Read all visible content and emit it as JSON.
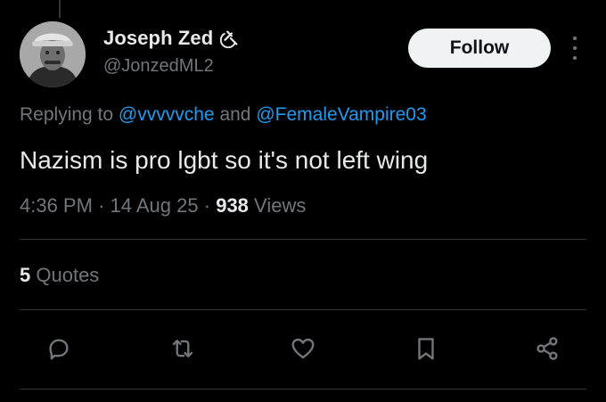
{
  "author": {
    "display_name": "Joseph Zed",
    "name_icon": "hammer-and-sickle-icon",
    "handle": "@JonzedML2"
  },
  "follow_label": "Follow",
  "reply_context": {
    "prefix": "Replying to",
    "mention_1": "@vvvvvche",
    "joiner": "and",
    "mention_2": "@FemaleVampire03"
  },
  "tweet": {
    "text": "Nazism is pro lgbt so it's not left wing",
    "time": "4:36 PM",
    "date": "14 Aug 25",
    "separator": "·",
    "views_count": "938",
    "views_label": "Views"
  },
  "stats": {
    "quotes_count": "5",
    "quotes_label": "Quotes"
  },
  "actions": [
    "reply-icon",
    "retweet-icon",
    "like-icon",
    "bookmark-icon",
    "share-icon"
  ],
  "colors": {
    "background": "#000000",
    "text": "#e7e9ea",
    "muted": "#71767b",
    "link": "#1d9bf0",
    "follow_bg": "#eff3f4",
    "divider": "#2f3336"
  }
}
